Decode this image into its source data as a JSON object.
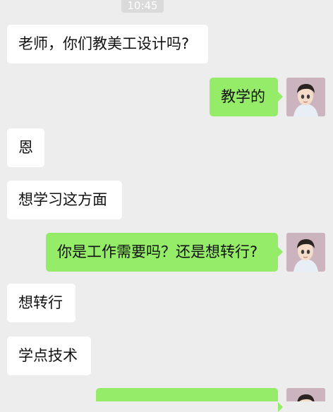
{
  "chat": {
    "timestamp": "10:45",
    "messages": [
      {
        "side": "left",
        "text": "老师，你们教美工设计吗?"
      },
      {
        "side": "right",
        "text": "教学的"
      },
      {
        "side": "left",
        "text": "恩"
      },
      {
        "side": "left",
        "text": "想学习这方面"
      },
      {
        "side": "right",
        "text": "你是工作需要吗？还是想转行?"
      },
      {
        "side": "left",
        "text": "想转行"
      },
      {
        "side": "left",
        "text": "学点技术"
      },
      {
        "side": "right",
        "text": ""
      }
    ]
  },
  "colors": {
    "background": "#ededed",
    "sent_bubble": "#95ec69",
    "received_bubble": "#ffffff"
  },
  "icons": {
    "self_avatar": "cartoon-boy-avatar"
  }
}
